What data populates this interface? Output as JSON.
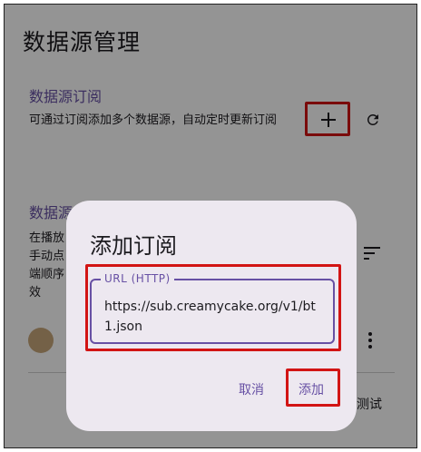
{
  "app": {
    "title": "数据源管理"
  },
  "subscription": {
    "title": "数据源订阅",
    "description": "可通过订阅添加多个数据源，自动定时更新订阅",
    "add_icon": "plus-icon",
    "refresh_icon": "refresh-icon"
  },
  "sources": {
    "title": "数据源",
    "description_lines": [
      "在播放",
      "手动点",
      "端顺序",
      "效"
    ],
    "sort_icon": "sort-icon",
    "more_icon": "more-vertical-icon",
    "test_label": "测试"
  },
  "dialog": {
    "title": "添加订阅",
    "field_label": "URL (HTTP)",
    "field_value": "https://sub.creamycake.org/v1/bt1.json",
    "cancel_label": "取消",
    "confirm_label": "添加"
  },
  "colors": {
    "accent": "#6750a4",
    "highlight": "#d21414",
    "dialog_bg": "#ede8f0"
  }
}
